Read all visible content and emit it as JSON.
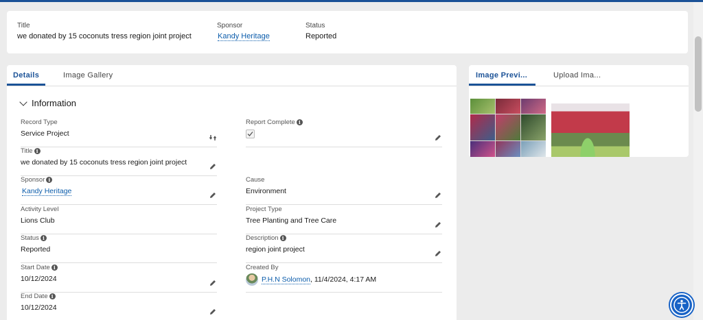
{
  "header": {
    "title_label": "Title",
    "title_value": "we donated by 15 coconuts tress region joint project",
    "sponsor_label": "Sponsor",
    "sponsor_value": "Kandy Heritage",
    "status_label": "Status",
    "status_value": "Reported"
  },
  "main_tabs": [
    {
      "label": "Details",
      "active": true
    },
    {
      "label": "Image Gallery",
      "active": false
    }
  ],
  "section": {
    "title": "Information"
  },
  "fields": {
    "record_type": {
      "label": "Record Type",
      "value": "Service Project"
    },
    "report_complete": {
      "label": "Report Complete",
      "checked": true
    },
    "title": {
      "label": "Title",
      "value": "we donated by 15 coconuts tress region joint project"
    },
    "sponsor": {
      "label": "Sponsor",
      "value": "Kandy Heritage"
    },
    "cause": {
      "label": "Cause",
      "value": "Environment"
    },
    "activity_level": {
      "label": "Activity Level",
      "value": "Lions Club"
    },
    "project_type": {
      "label": "Project Type",
      "value": "Tree Planting and Tree Care"
    },
    "status": {
      "label": "Status",
      "value": "Reported"
    },
    "description": {
      "label": "Description",
      "value": "region joint project"
    },
    "start_date": {
      "label": "Start Date",
      "value": "10/12/2024"
    },
    "created_by": {
      "label": "Created By",
      "user": "P.H.N Solomon",
      "datetime": ", 11/4/2024, 4:17 AM"
    },
    "end_date": {
      "label": "End Date",
      "value": "10/12/2024"
    }
  },
  "side_tabs": [
    {
      "label": "Image Previ...",
      "active": true
    },
    {
      "label": "Upload Ima...",
      "active": false
    }
  ],
  "colors": {
    "brand": "#1b5297",
    "link": "#0b5cab",
    "accessibility": "#1762c6"
  },
  "icons": [
    "edit-icon",
    "info-icon",
    "swap-record-type-icon",
    "chevron-down-icon",
    "accessibility-icon",
    "checkmark-icon"
  ]
}
